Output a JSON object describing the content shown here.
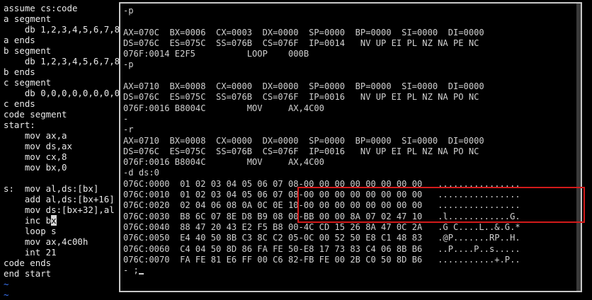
{
  "editor": {
    "lines": [
      "assume cs:code",
      "a segment",
      "    db 1,2,3,4,5,6,7,8",
      "a ends",
      "b segment",
      "    db 1,2,3,4,5,6,7,8",
      "b ends",
      "c segment",
      "    db 0,0,0,0,0,0,0,0",
      "c ends",
      "code segment",
      "start:",
      "    mov ax,a",
      "    mov ds,ax",
      "    mov cx,8",
      "    mov bx,0",
      "",
      "s:  mov al,ds:[bx]",
      "    add al,ds:[bx+16]",
      "    mov ds:[bx+32],al",
      "    inc bx",
      "    loop s",
      "    mov ax,4c00h",
      "    int 21",
      "code ends",
      "end start",
      "~",
      "~"
    ],
    "cursor_line": 20
  },
  "dos": {
    "lines": [
      "-p",
      "",
      "AX=070C  BX=0006  CX=0003  DX=0000  SP=0000  BP=0000  SI=0000  DI=0000",
      "DS=076C  ES=075C  SS=076B  CS=076F  IP=0014   NV UP EI PL NZ NA PE NC",
      "076F:0014 E2F5          LOOP    000B",
      "-p",
      "",
      "AX=0710  BX=0008  CX=0000  DX=0000  SP=0000  BP=0000  SI=0000  DI=0000",
      "DS=076C  ES=075C  SS=076B  CS=076F  IP=0016   NV UP EI PL NZ NA PO NC",
      "076F:0016 B8004C        MOV     AX,4C00",
      "-",
      "-r",
      "AX=0710  BX=0008  CX=0000  DX=0000  SP=0000  BP=0000  SI=0000  DI=0000",
      "DS=076C  ES=075C  SS=076B  CS=076F  IP=0016   NV UP EI PL NZ NA PO NC",
      "076F:0016 B8004C        MOV     AX,4C00",
      "-d ds:0",
      "076C:0000  01 02 03 04 05 06 07 08-00 00 00 00 00 00 00 00   ................",
      "076C:0010  01 02 03 04 05 06 07 08-00 00 00 00 00 00 00 00   ................",
      "076C:0020  02 04 06 08 0A 0C 0E 10-00 00 00 00 00 00 00 00   ................",
      "076C:0030  B8 6C 07 8E D8 B9 08 00-BB 00 00 8A 07 02 47 10   .l............G.",
      "076C:0040  88 47 20 43 E2 F5 B8 00-4C CD 15 26 8A 47 0C 2A   .G C....L..&.G.*",
      "076C:0050  E4 40 50 8B C3 8C C2 05-0C 00 52 50 E8 C1 48 83   .@P.......RP..H.",
      "076C:0060  C4 04 50 8D 86 FA FE 50-E8 17 73 83 C4 06 8B B6   ..P....P..s.....",
      "076C:0070  FA FE 81 E6 FF 00 C6 82-FB FE 00 2B C0 50 8D B6   ...........+.P..",
      "-"
    ],
    "prompt_suffix": " ;"
  }
}
